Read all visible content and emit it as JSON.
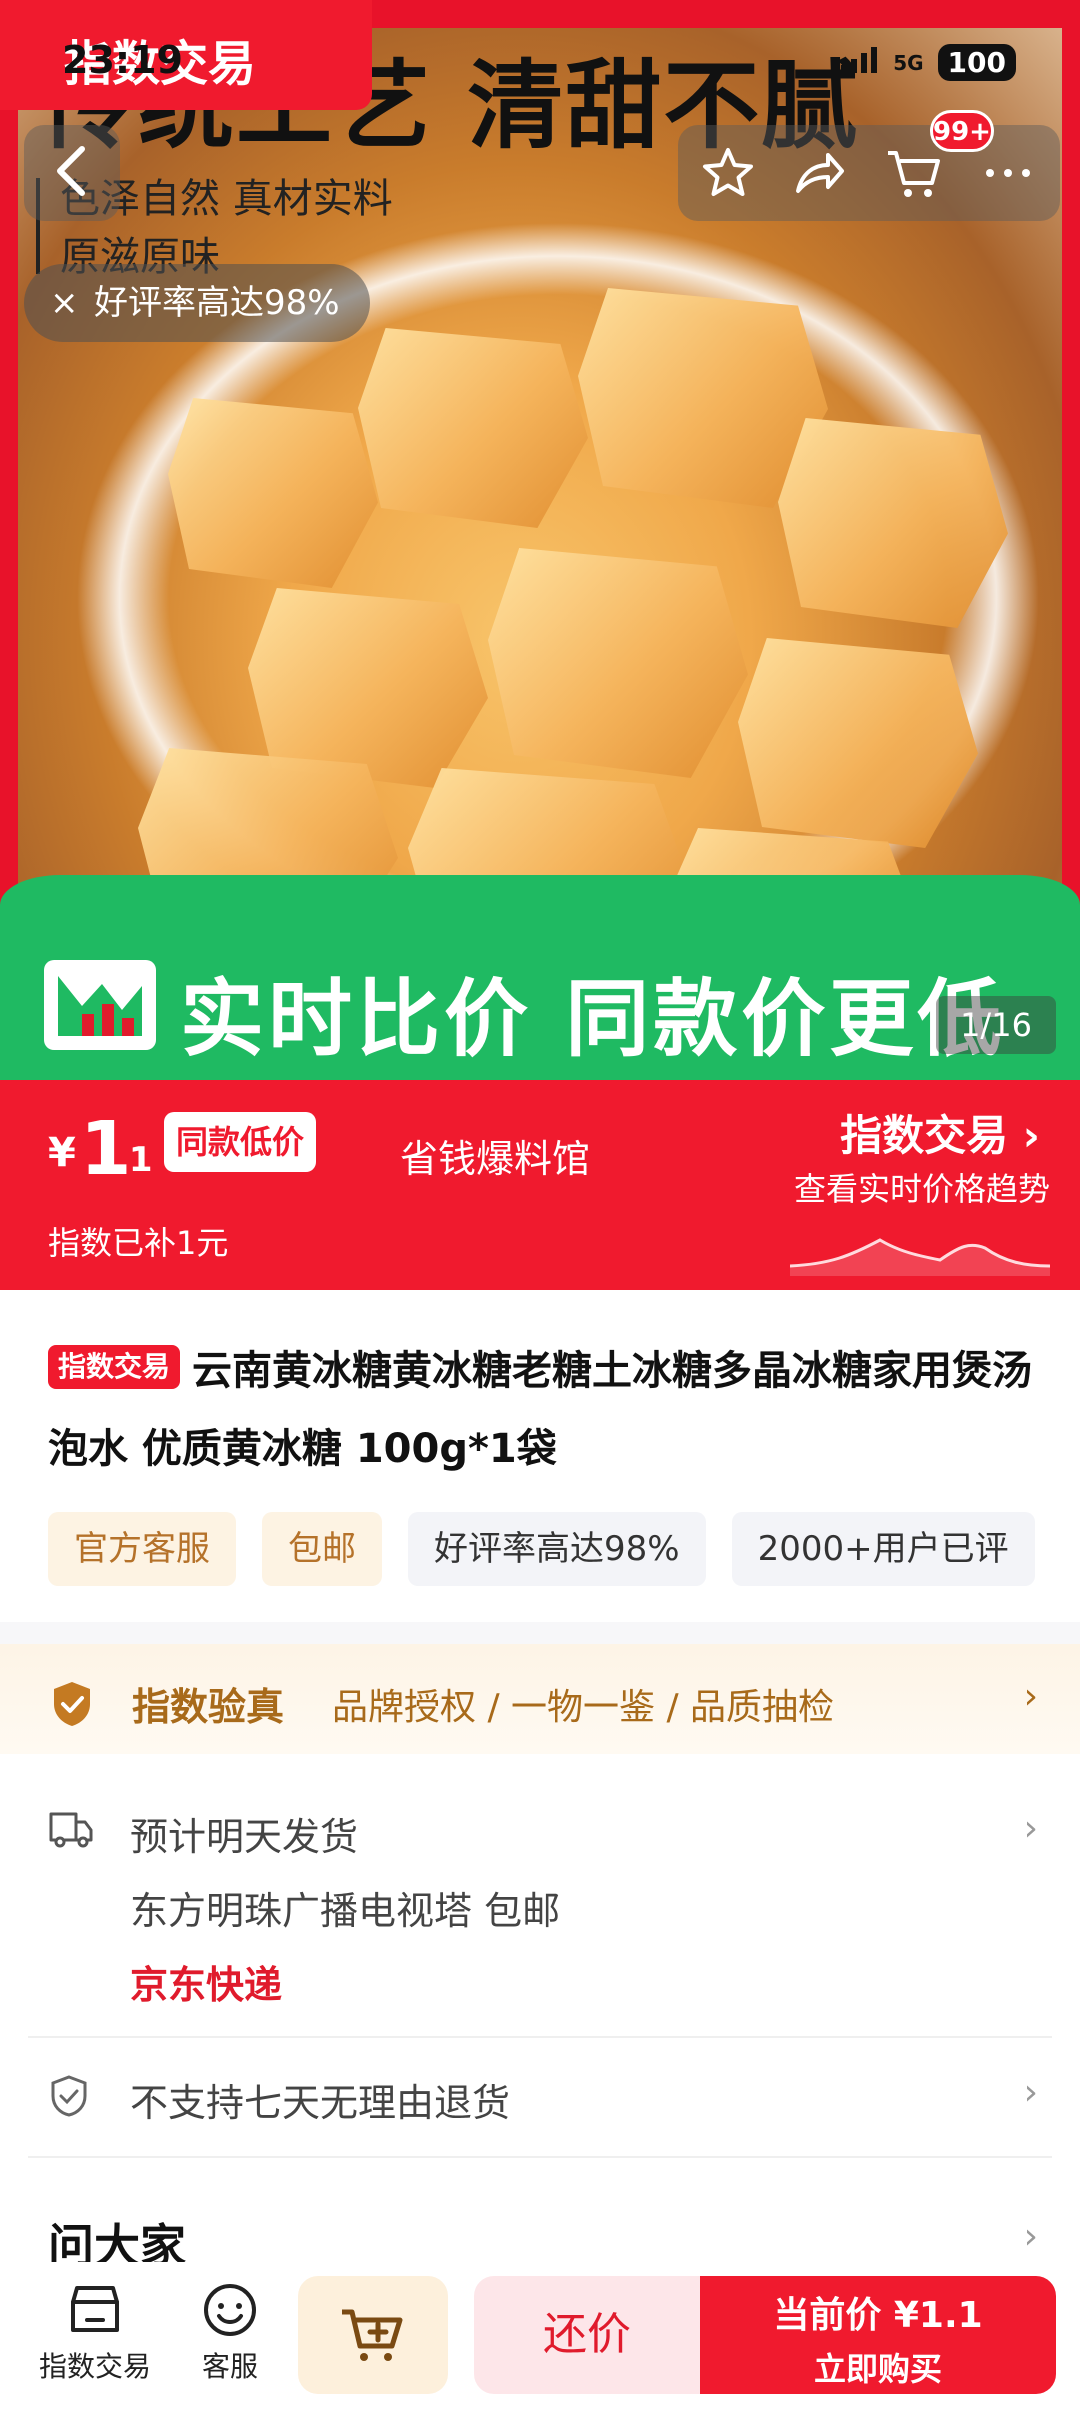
{
  "status_bar": {
    "time": "23:19",
    "network": "5G",
    "battery": "100"
  },
  "hero": {
    "top_tag": "指数交易",
    "headline": "传统工艺 清甜不腻",
    "sub_lines": [
      "色泽自然 真材实料",
      "原滋原味"
    ],
    "banner_text": "实时比价 同款价更低",
    "image_counter": "1/16"
  },
  "nav": {
    "cart_badge": "99+"
  },
  "praise_chip": {
    "close": "×",
    "text": "好评率高达98%"
  },
  "price": {
    "symbol": "¥",
    "int": "1",
    "dec": ".1",
    "low_badge": "同款低价",
    "shop_name": "省钱爆料馆",
    "subsidy": "指数已补1元",
    "index_title": "指数交易 ›",
    "index_sub": "查看实时价格趋势"
  },
  "product": {
    "tag": "指数交易",
    "title": "云南黄冰糖黄冰糖老糖土冰糖多晶冰糖家用煲汤泡水 优质黄冰糖 100g*1袋"
  },
  "chips": [
    "官方客服",
    "包邮",
    "好评率高达98%",
    "2000+用户已评"
  ],
  "verify": {
    "title": "指数验真",
    "desc": "品牌授权 / 一物一鉴 / 品质抽检"
  },
  "shipping": {
    "line1": "预计明天发货",
    "line2": "东方明珠广播电视塔 包邮",
    "courier": "京东快递"
  },
  "returns": {
    "text": "不支持七天无理由退货"
  },
  "ask": {
    "title": "问大家"
  },
  "bottom": {
    "index_label": "指数交易",
    "service_label": "客服",
    "bargain": "还价",
    "buy_line1": "当前价 ¥1.1",
    "buy_line2": "立即购买"
  },
  "chevron": "›",
  "colors": {
    "brand_red": "#f01a2e",
    "green": "#1fba62",
    "gold": "#a86a1a"
  }
}
